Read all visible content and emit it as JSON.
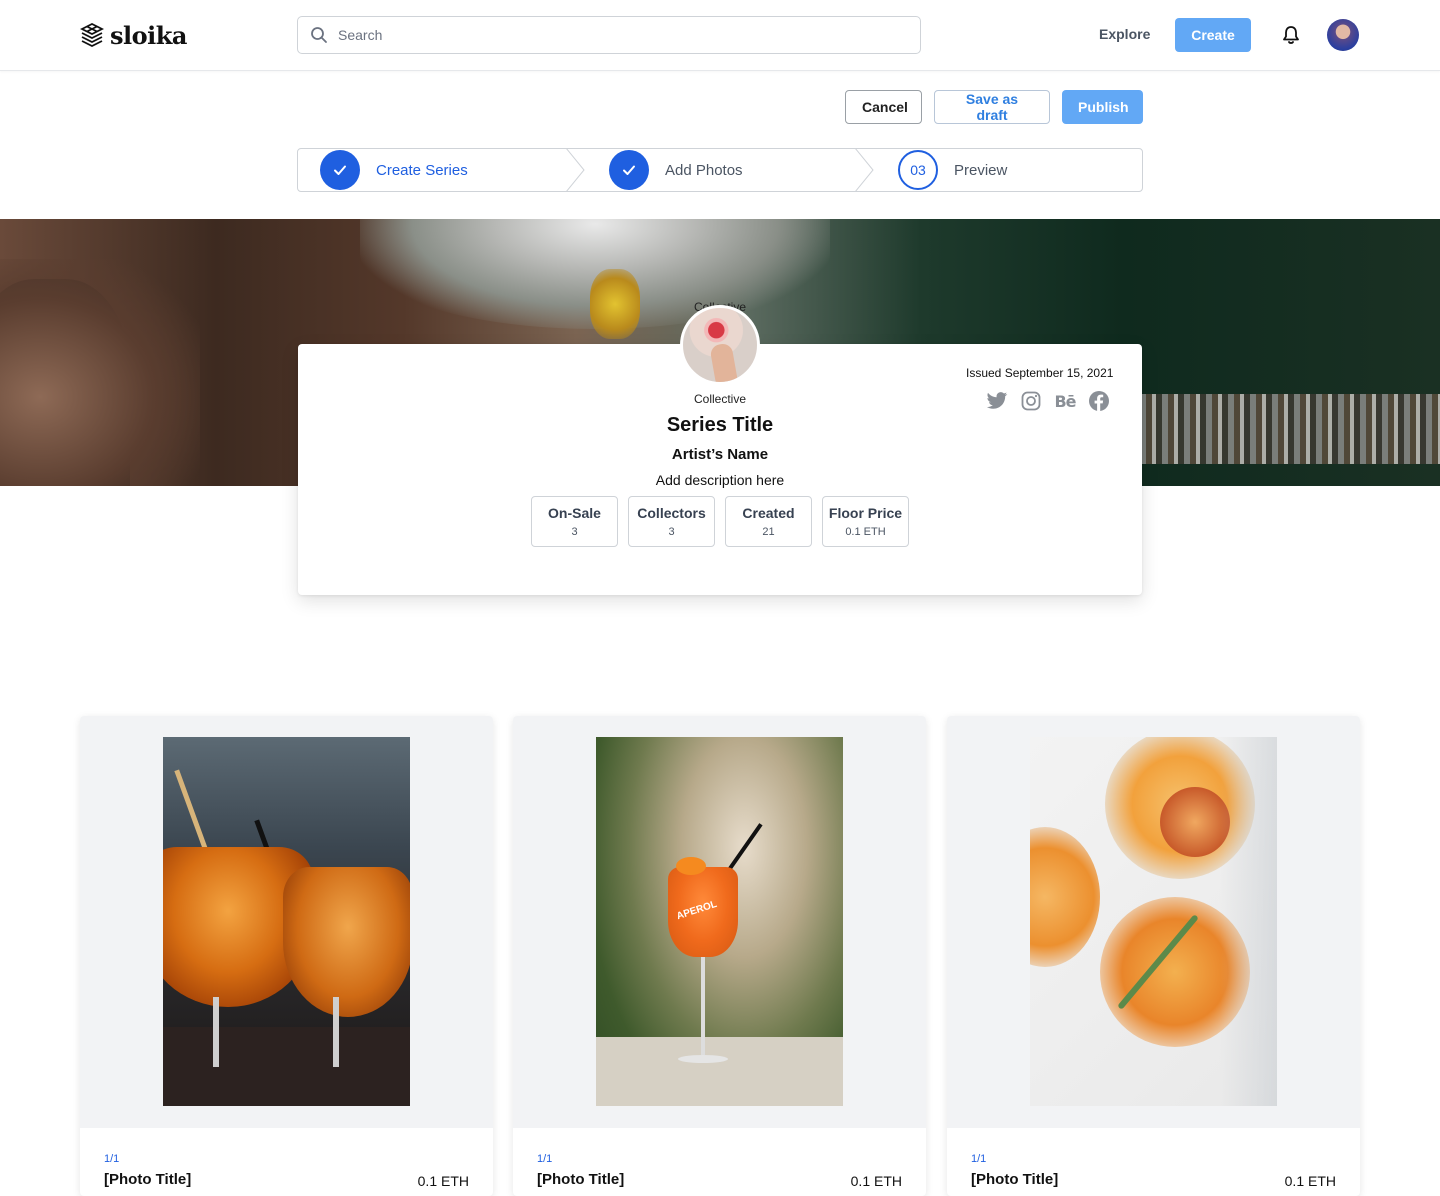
{
  "header": {
    "brand": "sloika",
    "search_placeholder": "Search",
    "explore_label": "Explore",
    "create_label": "Create"
  },
  "actions": {
    "cancel": "Cancel",
    "save_draft": "Save as draft",
    "publish": "Publish"
  },
  "stepper": {
    "steps": [
      {
        "label": "Create Series",
        "state": "done"
      },
      {
        "label": "Add Photos",
        "state": "done"
      },
      {
        "number": "03",
        "label": "Preview",
        "state": "current"
      }
    ]
  },
  "series": {
    "collective_ghost": "Collective",
    "collective": "Collective",
    "title": "Series Title",
    "artist": "Artist’s Name",
    "description": "Add description here",
    "issued": "Issued September 15, 2021",
    "stats": [
      {
        "label": "On-Sale",
        "value": "3"
      },
      {
        "label": "Collectors",
        "value": "3"
      },
      {
        "label": "Created",
        "value": "21"
      },
      {
        "label": "Floor Price",
        "value": "0.1 ETH"
      }
    ],
    "socials": [
      "twitter-icon",
      "instagram-icon",
      "behance-icon",
      "facebook-icon"
    ],
    "behance_glyph": "Bē"
  },
  "photos": [
    {
      "edition": "1/1",
      "title": "[Photo Title]",
      "price": "0.1 ETH"
    },
    {
      "edition": "1/1",
      "title": "[Photo Title]",
      "price": "0.1 ETH"
    },
    {
      "edition": "1/1",
      "title": "[Photo Title]",
      "price": "0.1 ETH"
    }
  ],
  "photo2_glass_text": "APEROL",
  "colors": {
    "primary": "#1f5fe0",
    "button_light_blue": "#62a8f5",
    "border": "#cfd3d8"
  }
}
